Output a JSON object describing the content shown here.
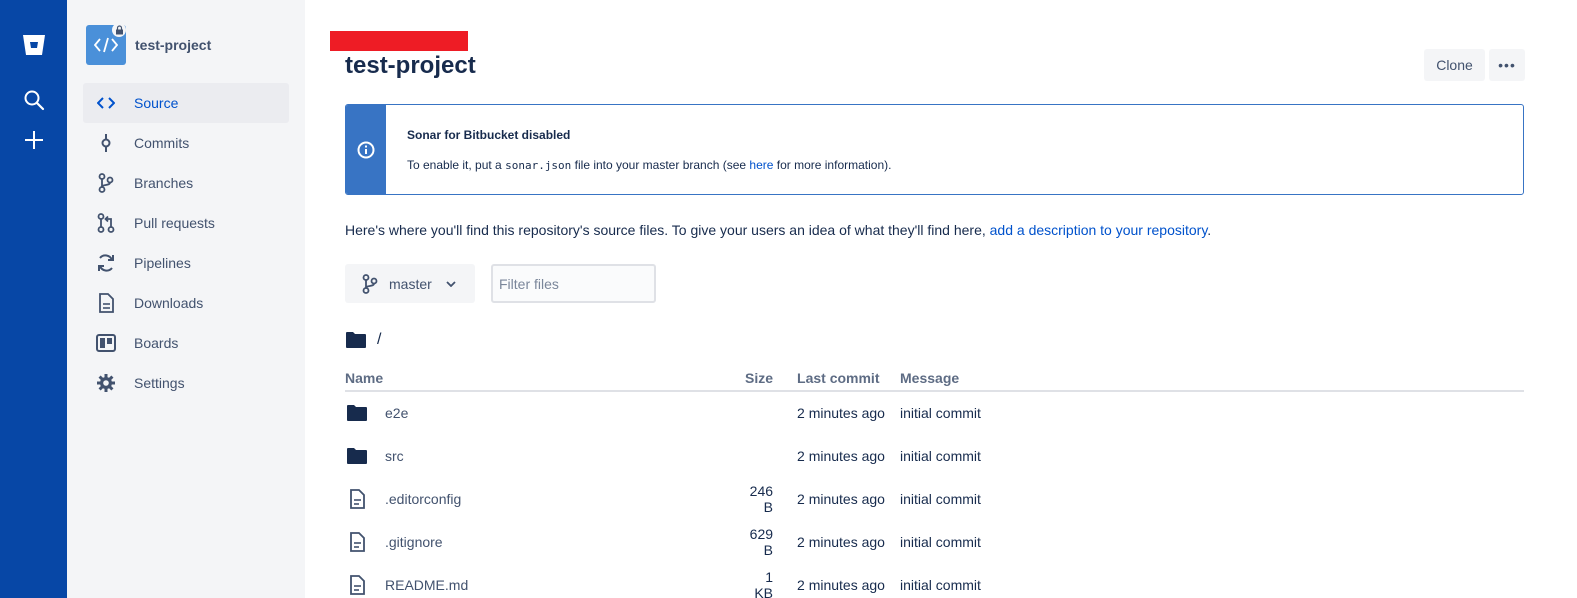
{
  "global_nav": {
    "icons": [
      "bitbucket-logo-icon",
      "search-icon",
      "create-plus-icon"
    ]
  },
  "sidebar": {
    "repo_name": "test-project",
    "items": [
      {
        "label": "Source",
        "icon": "source-code-icon",
        "active": true
      },
      {
        "label": "Commits",
        "icon": "commit-icon",
        "active": false
      },
      {
        "label": "Branches",
        "icon": "branch-icon",
        "active": false
      },
      {
        "label": "Pull requests",
        "icon": "pull-request-icon",
        "active": false
      },
      {
        "label": "Pipelines",
        "icon": "pipelines-icon",
        "active": false
      },
      {
        "label": "Downloads",
        "icon": "download-document-icon",
        "active": false
      },
      {
        "label": "Boards",
        "icon": "board-icon",
        "active": false
      },
      {
        "label": "Settings",
        "icon": "gear-icon",
        "active": false
      }
    ]
  },
  "header": {
    "title": "test-project",
    "clone_label": "Clone",
    "more_label": "•••"
  },
  "banner": {
    "title": "Sonar for Bitbucket disabled",
    "text_before": "To enable it, put a ",
    "code": "sonar.json",
    "text_middle": " file into your master branch (see ",
    "link": "here",
    "text_after": " for more information)."
  },
  "description": {
    "text": "Here's where you'll find this repository's source files. To give your users an idea of what they'll find here, ",
    "link": "add a description to your repository",
    "suffix": "."
  },
  "branch": {
    "label": "master"
  },
  "filter": {
    "placeholder": "Filter files"
  },
  "path": {
    "label": "/"
  },
  "table": {
    "headers": {
      "name": "Name",
      "size": "Size",
      "last_commit": "Last commit",
      "message": "Message"
    },
    "rows": [
      {
        "name": "e2e",
        "type": "folder",
        "size": "",
        "last_commit": "2 minutes ago",
        "message": "initial commit"
      },
      {
        "name": "src",
        "type": "folder",
        "size": "",
        "last_commit": "2 minutes ago",
        "message": "initial commit"
      },
      {
        "name": ".editorconfig",
        "type": "file",
        "size": "246 B",
        "last_commit": "2 minutes ago",
        "message": "initial commit"
      },
      {
        "name": ".gitignore",
        "type": "file",
        "size": "629 B",
        "last_commit": "2 minutes ago",
        "message": "initial commit"
      },
      {
        "name": "README.md",
        "type": "file",
        "size": "1 KB",
        "last_commit": "2 minutes ago",
        "message": "initial commit"
      }
    ]
  },
  "colors": {
    "global_nav": "#0747a6",
    "sidebar_bg": "#f4f5f7",
    "link": "#0052cc",
    "banner_accent": "#3874c4",
    "redaction": "#ee1c25"
  }
}
